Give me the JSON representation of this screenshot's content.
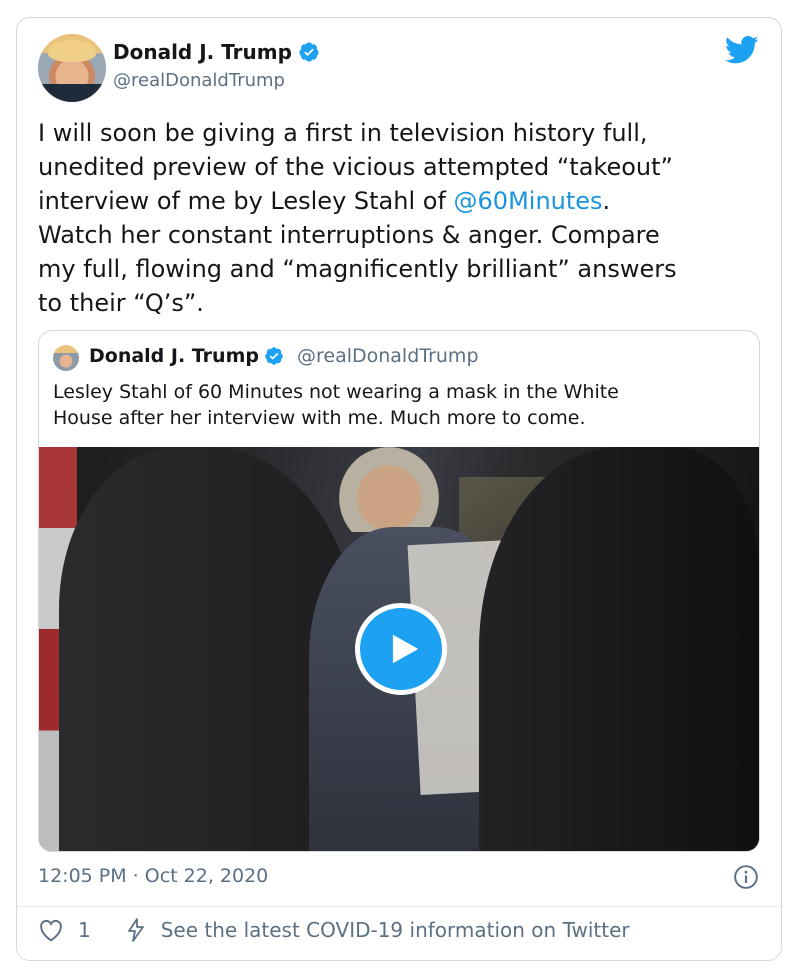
{
  "tweet": {
    "author_name": "Donald J. Trump",
    "author_handle": "@realDonaldTrump",
    "text_before_mention": "I will soon be giving a first in television history full,\nunedited preview of the vicious attempted “takeout”\ninterview of me by Lesley Stahl of ",
    "mention": "@60Minutes",
    "text_after_mention": ".\nWatch her constant interruptions & anger. Compare\nmy full, flowing and “magnificently brilliant” answers\nto their “Q’s”.",
    "timestamp": "12:05 PM · Oct 22, 2020",
    "like_count": "1",
    "covid_link": "See the latest COVID-19 information on Twitter"
  },
  "quoted_tweet": {
    "author_name": "Donald J. Trump",
    "author_handle": "@realDonaldTrump",
    "text": "Lesley Stahl of 60 Minutes not wearing a mask in the White\nHouse after her interview with me. Much more to come."
  },
  "icons": {
    "brand": "twitter-bird-icon",
    "verified": "verified-badge-icon",
    "play": "play-icon",
    "info": "info-icon",
    "like": "heart-icon",
    "covid": "bolt-icon"
  },
  "colors": {
    "brand_blue": "#1da1f2",
    "link_blue": "#1b95e0",
    "secondary_text": "#5b7083",
    "border": "#cfd9de"
  }
}
